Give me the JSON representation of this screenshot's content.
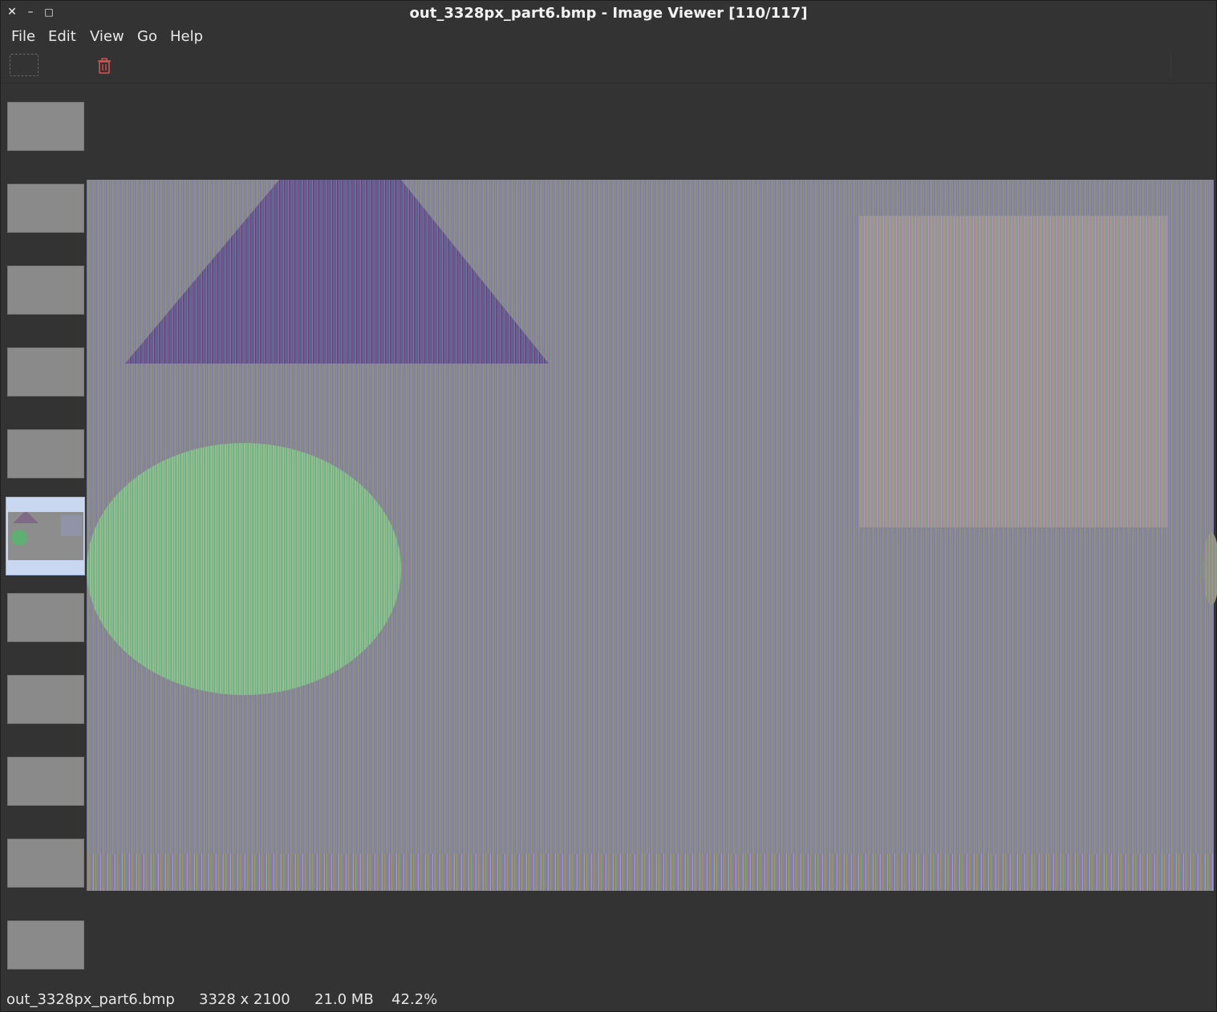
{
  "window": {
    "title": "out_3328px_part6.bmp - Image Viewer [110/117]",
    "close_glyph": "✕",
    "minimize_glyph": "–",
    "maximize_glyph": "□"
  },
  "menu": {
    "items": [
      "File",
      "Edit",
      "View",
      "Go",
      "Help"
    ]
  },
  "toolbar": {
    "trash_icon": "trash-icon",
    "trash_color": "#d9534f"
  },
  "thumbnails": {
    "count_visible": 11,
    "selected_index": 5
  },
  "viewer": {
    "image_name": "out_3328px_part6.bmp"
  },
  "status": {
    "filename": "out_3328px_part6.bmp",
    "dimensions": "3328 x 2100",
    "filesize": "21.0 MB",
    "zoom": "42.2%"
  }
}
